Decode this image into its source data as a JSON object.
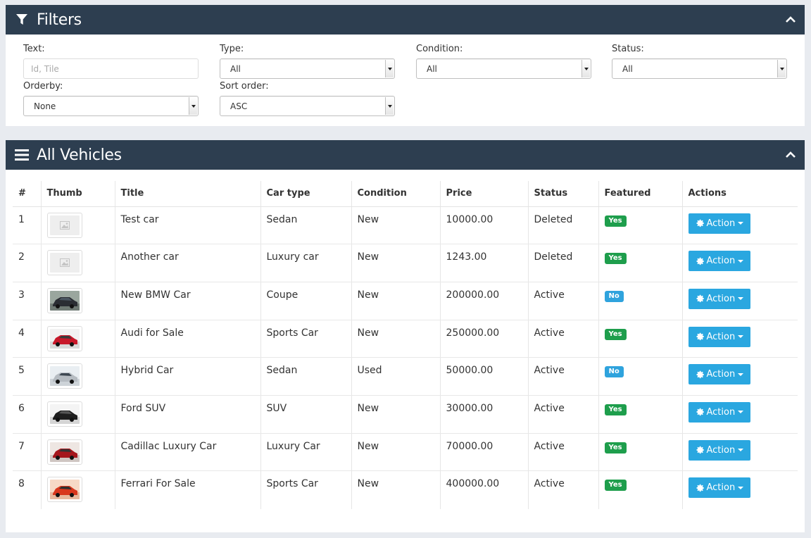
{
  "filters": {
    "title": "Filters",
    "text_label": "Text:",
    "text_placeholder": "Id, Tile",
    "type_label": "Type:",
    "type_value": "All",
    "condition_label": "Condition:",
    "condition_value": "All",
    "status_label": "Status:",
    "status_value": "All",
    "orderby_label": "Orderby:",
    "orderby_value": "None",
    "sortorder_label": "Sort order:",
    "sortorder_value": "ASC"
  },
  "vehicles": {
    "title": "All Vehicles",
    "columns": [
      "#",
      "Thumb",
      "Title",
      "Car type",
      "Condition",
      "Price",
      "Status",
      "Featured",
      "Actions"
    ],
    "action_label": "Action",
    "rows": [
      {
        "num": "1",
        "title": "Test car",
        "type": "Sedan",
        "condition": "New",
        "price": "10000.00",
        "status": "Deleted",
        "featured": "Yes",
        "thumb": "placeholder"
      },
      {
        "num": "2",
        "title": "Another car",
        "type": "Luxury car",
        "condition": "New",
        "price": "1243.00",
        "status": "Deleted",
        "featured": "Yes",
        "thumb": "placeholder"
      },
      {
        "num": "3",
        "title": "New BMW Car",
        "type": "Coupe",
        "condition": "New",
        "price": "200000.00",
        "status": "Active",
        "featured": "No",
        "thumb": "dark-car"
      },
      {
        "num": "4",
        "title": "Audi for Sale",
        "type": "Sports Car",
        "condition": "New",
        "price": "250000.00",
        "status": "Active",
        "featured": "Yes",
        "thumb": "red-car"
      },
      {
        "num": "5",
        "title": "Hybrid Car",
        "type": "Sedan",
        "condition": "Used",
        "price": "50000.00",
        "status": "Active",
        "featured": "No",
        "thumb": "silver-car"
      },
      {
        "num": "6",
        "title": "Ford SUV",
        "type": "SUV",
        "condition": "New",
        "price": "30000.00",
        "status": "Active",
        "featured": "Yes",
        "thumb": "black-suv"
      },
      {
        "num": "7",
        "title": "Cadillac Luxury Car",
        "type": "Luxury Car",
        "condition": "New",
        "price": "70000.00",
        "status": "Active",
        "featured": "Yes",
        "thumb": "red-sedan"
      },
      {
        "num": "8",
        "title": "Ferrari For Sale",
        "type": "Sports Car",
        "condition": "New",
        "price": "400000.00",
        "status": "Active",
        "featured": "Yes",
        "thumb": "orange-car"
      }
    ]
  },
  "colors": {
    "header_bg": "#2d3e50",
    "action_button": "#2aa7e0",
    "badge_yes": "#1e9e4c",
    "badge_no": "#2fa3dd"
  }
}
